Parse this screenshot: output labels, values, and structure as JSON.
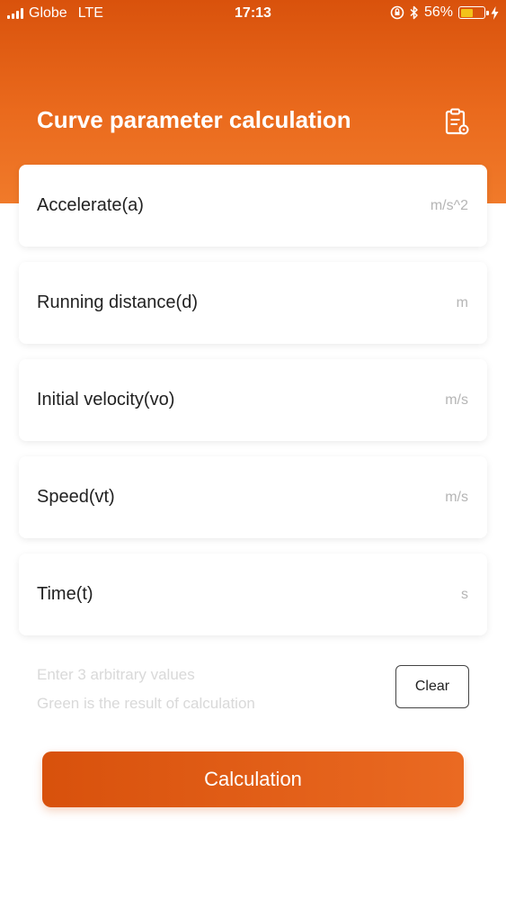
{
  "status_bar": {
    "carrier": "Globe",
    "network": "LTE",
    "time": "17:13",
    "battery_percent_text": "56%",
    "battery_level": 0.56,
    "icons": [
      "signal-icon",
      "orientation-lock-icon",
      "bluetooth-icon",
      "battery-icon",
      "charging-icon"
    ]
  },
  "header": {
    "title": "Curve parameter calculation",
    "history_icon": "clipboard-history-icon"
  },
  "fields": [
    {
      "label": "Accelerate(a)",
      "unit": "m/s^2"
    },
    {
      "label": "Running distance(d)",
      "unit": "m"
    },
    {
      "label": "Initial velocity(vo)",
      "unit": "m/s"
    },
    {
      "label": "Speed(vt)",
      "unit": "m/s"
    },
    {
      "label": "Time(t)",
      "unit": "s"
    }
  ],
  "hints": {
    "line1": "Enter 3 arbitrary values",
    "line2": "Green is the result of calculation"
  },
  "buttons": {
    "clear": "Clear",
    "calculate": "Calculation"
  },
  "colors": {
    "accent": "#e2601a",
    "battery_fill": "#f3c21a",
    "hint_text": "#d9d9d9"
  }
}
